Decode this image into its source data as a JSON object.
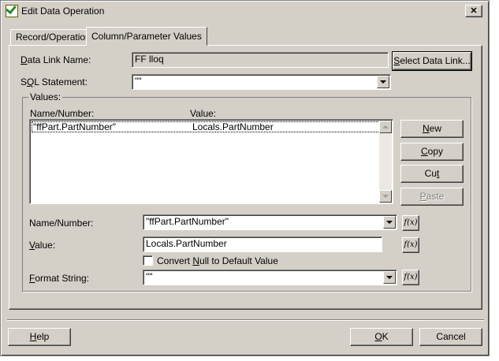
{
  "window": {
    "title": "Edit Data Operation",
    "close_glyph": "✕"
  },
  "tabs": [
    {
      "label": "Record/Operation",
      "active": false
    },
    {
      "label": "Column/Parameter Values",
      "active": true
    }
  ],
  "data_link": {
    "label_u": "D",
    "label_rest": "ata Link Name:",
    "value": "FF lloq"
  },
  "select_link_button": {
    "label_u": "S",
    "label_rest": "elect Data Link..."
  },
  "sql": {
    "label_pre": "S",
    "label_u": "Q",
    "label_rest": "L Statement:",
    "value": "\"\""
  },
  "values_group": {
    "title": "Values:",
    "col_name": "Name/Number:",
    "col_value": "Value:",
    "rows": [
      {
        "name": "\"ffPart.PartNumber\"",
        "value": "Locals.PartNumber"
      }
    ]
  },
  "side_buttons": {
    "new": {
      "label_u": "N",
      "label_rest": "ew"
    },
    "copy": {
      "label_u": "C",
      "label_rest": "opy"
    },
    "cut": {
      "label_pre": "Cu",
      "label_u": "t"
    },
    "paste": {
      "label_u": "P",
      "label_rest": "aste"
    }
  },
  "name_number": {
    "label": "Name/Number:",
    "value": "\"ffPart.PartNumber\""
  },
  "value_field": {
    "label_u": "V",
    "label_rest": "alue:",
    "value": "Locals.PartNumber"
  },
  "convert_null": {
    "label_pre": "Convert ",
    "label_u": "N",
    "label_rest": "ull to Default Value",
    "checked": false
  },
  "format_string": {
    "label_u": "F",
    "label_rest": "ormat String:",
    "value": "\"\""
  },
  "fx_label": "f(x)",
  "footer": {
    "help": {
      "label_u": "H",
      "label_rest": "elp"
    },
    "ok": {
      "label_u": "O",
      "label_rest": "K"
    },
    "cancel": {
      "label": "Cancel"
    }
  },
  "colors": {
    "face": "#d4d0c8",
    "shadow": "#808080",
    "field": "#ffffff"
  }
}
